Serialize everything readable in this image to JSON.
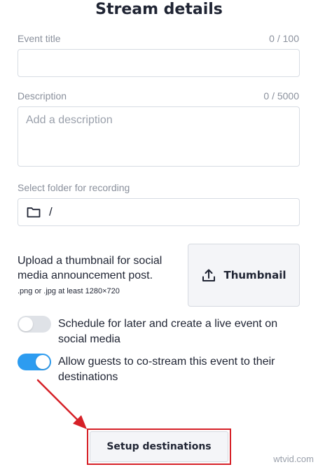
{
  "header": {
    "title": "Stream details"
  },
  "event_title": {
    "label": "Event title",
    "counter": "0 / 100",
    "value": "",
    "placeholder": ""
  },
  "description": {
    "label": "Description",
    "counter": "0 / 5000",
    "value": "",
    "placeholder": "Add a description"
  },
  "folder": {
    "label": "Select folder for recording",
    "path": "/",
    "icon": "folder-icon"
  },
  "thumbnail": {
    "text": "Upload a thumbnail for social media announcement post.",
    "hint": ".png or .jpg at least 1280×720",
    "button_label": "Thumbnail",
    "icon": "upload-icon"
  },
  "options": [
    {
      "label": "Schedule for later and create a live event on social media",
      "enabled": false
    },
    {
      "label": "Allow guests to co-stream this event to their destinations",
      "enabled": true
    }
  ],
  "footer": {
    "setup_label": "Setup destinations"
  },
  "watermark": "wtvid.com",
  "colors": {
    "accent": "#2d9cf0",
    "toggle_off": "#dfe2e7",
    "highlight": "#d62027"
  }
}
